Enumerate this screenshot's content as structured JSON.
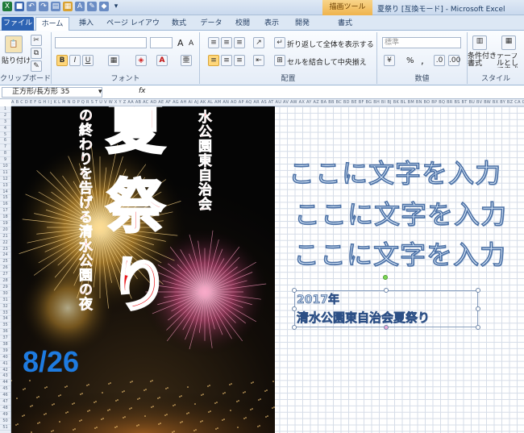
{
  "window": {
    "title": "夏祭り [互換モード] - Microsoft Excel",
    "context_tab": "描画ツール"
  },
  "tabs": [
    {
      "label": "ファイル"
    },
    {
      "label": "ホーム"
    },
    {
      "label": "挿入"
    },
    {
      "label": "ページ レイアウト"
    },
    {
      "label": "数式"
    },
    {
      "label": "データ"
    },
    {
      "label": "校閲"
    },
    {
      "label": "表示"
    },
    {
      "label": "開発"
    },
    {
      "label": "書式"
    }
  ],
  "ribbon": {
    "clipboard": {
      "label": "クリップボード",
      "paste": "貼り付け"
    },
    "font": {
      "label": "フォント",
      "bold": "B",
      "italic": "I",
      "underline": "U",
      "grow": "A",
      "shrink": "A"
    },
    "alignment": {
      "label": "配置",
      "wrap_text": "折り返して全体を表示する",
      "merge": "セルを結合して中央揃え"
    },
    "number": {
      "label": "数値",
      "format": "標準",
      "percent": "%",
      "comma": ","
    },
    "styles": {
      "label": "スタイル",
      "conditional": "条件付き書式",
      "table": "テーブルとして書式設定"
    }
  },
  "formula_bar": {
    "name_box": "正方形/長方形 35",
    "fx": "fx",
    "content": ""
  },
  "poster": {
    "title_chars": [
      "夏",
      "祭",
      "り"
    ],
    "left_vertical": "の終わりを告げる清水公園の夜",
    "right_vertical": "水公園東自治会",
    "date": "8/26"
  },
  "wordart": {
    "line1": "ここに文字を入力",
    "line2": "ここに文字を入力",
    "line3": "ここに文字を入力"
  },
  "selected_textbox": {
    "line1": "2017年",
    "line2": "清水公園東自治会夏祭り"
  },
  "colors": {
    "title_red": "#e8171b",
    "date_blue": "#1e7be0",
    "wordart_fill": "#d6e6f7",
    "wordart_stroke": "#4a6fa4"
  }
}
